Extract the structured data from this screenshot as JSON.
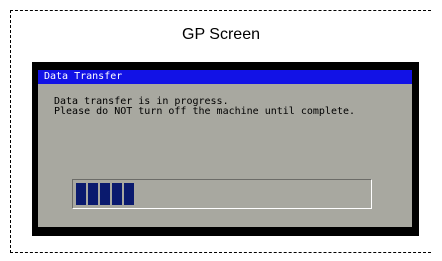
{
  "figure": {
    "caption": "GP Screen"
  },
  "dialog": {
    "title": "Data Transfer",
    "message_line1": "Data transfer is in progress.",
    "message_line2": "Please do NOT turn off the machine until complete.",
    "progress_segments_filled": 5,
    "title_color": "#1212e6",
    "body_color": "#a8a8a0",
    "progress_color": "#0a1a6e"
  }
}
